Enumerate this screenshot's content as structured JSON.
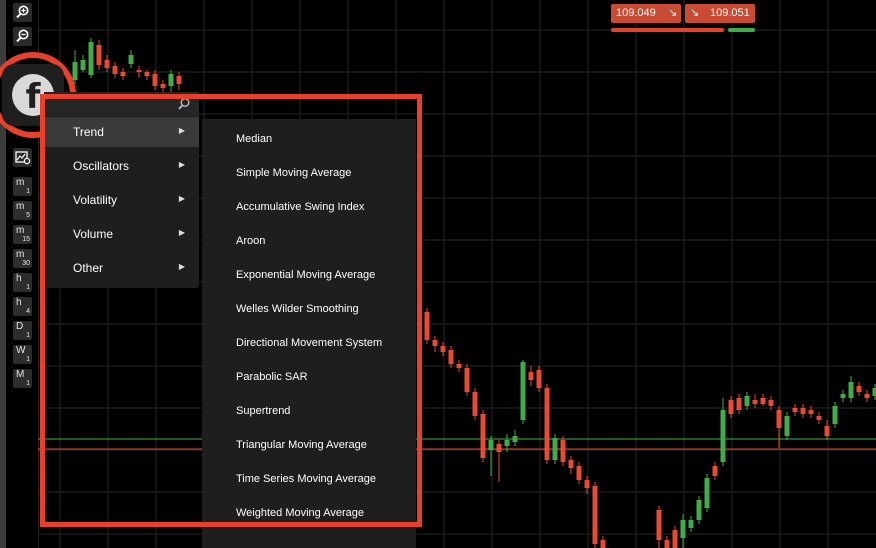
{
  "colors": {
    "accent_red": "#e8412b",
    "candle_up": "#3fae49",
    "candle_down": "#e84a34",
    "menu_bg": "#1e1e1e",
    "menu_active": "#3a3a3a",
    "grid": "#262626"
  },
  "toolbar": {
    "zoom_in_icon": "zoom-in-icon",
    "zoom_out_icon": "zoom-out-icon",
    "logo_icon": "facebook-icon",
    "logo_letter": "f",
    "settings_icon": "chart-settings-icon",
    "timeframes": [
      {
        "unit": "m",
        "num": "1"
      },
      {
        "unit": "m",
        "num": "5"
      },
      {
        "unit": "m",
        "num": "15"
      },
      {
        "unit": "m",
        "num": "30"
      },
      {
        "unit": "h",
        "num": "1"
      },
      {
        "unit": "h",
        "num": "4"
      },
      {
        "unit": "D",
        "num": "1"
      },
      {
        "unit": "W",
        "num": "1"
      },
      {
        "unit": "M",
        "num": "1"
      }
    ]
  },
  "prices": {
    "sell": "109.049",
    "buy": "109.051",
    "sell_arrow": "↘",
    "buy_arrow": "↘"
  },
  "menu": {
    "search_icon": "search-icon",
    "items": [
      {
        "label": "Trend",
        "caret": "▶"
      },
      {
        "label": "Oscillators",
        "caret": "▶"
      },
      {
        "label": "Volatility",
        "caret": "▶"
      },
      {
        "label": "Volume",
        "caret": "▶"
      },
      {
        "label": "Other",
        "caret": "▶"
      }
    ],
    "active_index": 0
  },
  "submenu": {
    "items": [
      {
        "label": "Median"
      },
      {
        "label": "Simple Moving Average"
      },
      {
        "label": "Accumulative Swing Index"
      },
      {
        "label": "Aroon"
      },
      {
        "label": "Exponential Moving Average"
      },
      {
        "label": "Welles Wilder Smoothing"
      },
      {
        "label": "Directional Movement System"
      },
      {
        "label": "Parabolic SAR"
      },
      {
        "label": "Supertrend"
      },
      {
        "label": "Triangular Moving Average"
      },
      {
        "label": "Time Series Moving Average"
      },
      {
        "label": "Weighted Moving Average"
      }
    ]
  }
}
